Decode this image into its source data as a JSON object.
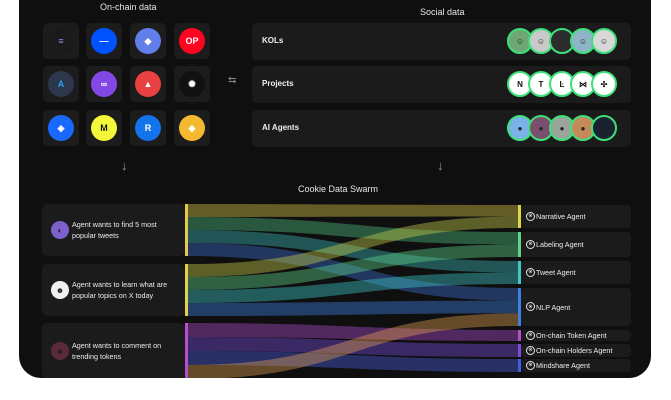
{
  "onchain": {
    "title": "On-chain data",
    "chains": [
      {
        "icon": "solana-icon",
        "glyph": "≡",
        "bg": "#1a1a1a",
        "fg": "#b57cff"
      },
      {
        "icon": "base-icon",
        "glyph": "—",
        "bg": "#0052ff",
        "fg": "#ffffff"
      },
      {
        "icon": "ethereum-icon",
        "glyph": "◆",
        "bg": "#627eea",
        "fg": "#ffffff"
      },
      {
        "icon": "optimism-icon",
        "glyph": "OP",
        "bg": "#ff0420",
        "fg": "#ffffff"
      },
      {
        "icon": "arbitrum-icon",
        "glyph": "A",
        "bg": "#2d374b",
        "fg": "#28a0f0"
      },
      {
        "icon": "polygon-icon",
        "glyph": "∞",
        "bg": "#8247e5",
        "fg": "#ffffff"
      },
      {
        "icon": "avalanche-icon",
        "glyph": "▲",
        "bg": "#e84142",
        "fg": "#ffffff"
      },
      {
        "icon": "sei-icon",
        "glyph": "✺",
        "bg": "#111111",
        "fg": "#ffffff"
      },
      {
        "icon": "fantom-icon",
        "glyph": "◈",
        "bg": "#1969ff",
        "fg": "#ffffff"
      },
      {
        "icon": "mantle-icon",
        "glyph": "M",
        "bg": "#f4f73a",
        "fg": "#111111"
      },
      {
        "icon": "ronin-icon",
        "glyph": "R",
        "bg": "#1273ea",
        "fg": "#ffffff"
      },
      {
        "icon": "bnb-icon",
        "glyph": "◆",
        "bg": "#f3ba2f",
        "fg": "#ffffff"
      }
    ]
  },
  "swap_symbol": "⇆",
  "social": {
    "title": "Social data",
    "rows": [
      {
        "label": "KOLs",
        "avatars": [
          {
            "icon": "kol-avatar-icon",
            "glyph": "☺",
            "bg": "#6fa774"
          },
          {
            "icon": "kol-avatar-icon",
            "glyph": "☺",
            "bg": "#c9c9c9"
          },
          {
            "icon": "kol-avatar-icon",
            "glyph": "☺",
            "bg": "#2c2c2c"
          },
          {
            "icon": "kol-avatar-icon",
            "glyph": "☺",
            "bg": "#8fb4c8"
          },
          {
            "icon": "kol-avatar-icon",
            "glyph": "☺",
            "bg": "#d8d8d8"
          }
        ]
      },
      {
        "label": "Projects",
        "avatars": [
          {
            "icon": "project-logo-icon",
            "glyph": "N",
            "bg": "#ffffff"
          },
          {
            "icon": "project-logo-icon",
            "glyph": "T",
            "bg": "#ffffff"
          },
          {
            "icon": "project-logo-icon",
            "glyph": "Ŀ",
            "bg": "#ffffff"
          },
          {
            "icon": "project-logo-icon",
            "glyph": "⋈",
            "bg": "#ffffff"
          },
          {
            "icon": "project-logo-icon",
            "glyph": "✣",
            "bg": "#ffffff"
          }
        ]
      },
      {
        "label": "AI Agents",
        "avatars": [
          {
            "icon": "ai-agent-avatar-icon",
            "glyph": "●",
            "bg": "#7ab1e8"
          },
          {
            "icon": "ai-agent-avatar-icon",
            "glyph": "●",
            "bg": "#7a4f6e"
          },
          {
            "icon": "ai-agent-avatar-icon",
            "glyph": "●",
            "bg": "#9aa49a"
          },
          {
            "icon": "ai-agent-avatar-icon",
            "glyph": "●",
            "bg": "#c48a5a"
          },
          {
            "icon": "ai-agent-avatar-icon",
            "glyph": "●",
            "bg": "#1a2230"
          }
        ]
      }
    ]
  },
  "arrows": {
    "left": "↓",
    "right": "↓"
  },
  "swarm_title": "Cookie Data Swarm",
  "tasks": [
    {
      "text": "Agent wants to find 5 most popular tweets",
      "icon": "cookie-agent-icon",
      "glyph": "◐",
      "bg": "#7b61c9",
      "bar": "#e3c84a"
    },
    {
      "text": "Agent wants to learn what are popular topics on X today",
      "icon": "agent-avatar-icon",
      "glyph": "☻",
      "bg": "#f0f0f0",
      "bar": "#e3d04a"
    },
    {
      "text": "Agent wants to comment on trending tokens",
      "icon": "agent-avatar-icon",
      "glyph": "☻",
      "bg": "#5a2a3a",
      "bar": "#b44fd0"
    }
  ],
  "agents": [
    {
      "name": "Narrative Agent",
      "icon": "x-logo-icon",
      "bar": "#e2d34c"
    },
    {
      "name": "Labeling Agent",
      "icon": "x-logo-icon",
      "bar": "#5ed48a"
    },
    {
      "name": "Tweet Agent",
      "icon": "x-logo-icon",
      "bar": "#40c8c8"
    },
    {
      "name": "NLP Agent",
      "icon": "x-logo-icon",
      "bar": "#3f7fe0"
    },
    {
      "name": "On-chain Token Agent",
      "icon": "x-logo-icon",
      "bar": "#b04fd0"
    },
    {
      "name": "On-chain Holders Agent",
      "icon": "x-logo-icon",
      "bar": "#7a4fe0"
    },
    {
      "name": "Mindshare Agent",
      "icon": "x-logo-icon",
      "bar": "#3f5fe0"
    }
  ],
  "agent_glyph": "⊗",
  "flows": [
    {
      "from": 0,
      "to": 0,
      "color": "#d8c84a"
    },
    {
      "from": 0,
      "to": 1,
      "color": "#4fbf80"
    },
    {
      "from": 0,
      "to": 2,
      "color": "#3fb8b8"
    },
    {
      "from": 0,
      "to": 3,
      "color": "#3f6fd0"
    },
    {
      "from": 1,
      "to": 0,
      "color": "#c8d04a"
    },
    {
      "from": 1,
      "to": 1,
      "color": "#5ed48a"
    },
    {
      "from": 1,
      "to": 2,
      "color": "#40c8c8"
    },
    {
      "from": 1,
      "to": 3,
      "color": "#3f7fe0"
    },
    {
      "from": 2,
      "to": 4,
      "color": "#b04fd0"
    },
    {
      "from": 2,
      "to": 5,
      "color": "#7a4fe0"
    },
    {
      "from": 2,
      "to": 6,
      "color": "#4f5fe0"
    },
    {
      "from": 2,
      "to": 3,
      "color": "#e0a050"
    }
  ]
}
